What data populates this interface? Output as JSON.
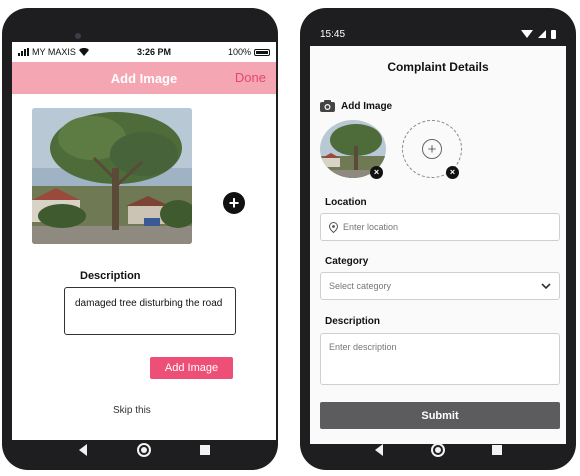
{
  "left_phone": {
    "status": {
      "carrier": "MY MAXIS",
      "time": "3:26 PM",
      "battery": "100%"
    },
    "header": {
      "title": "Add Image",
      "done_label": "Done"
    },
    "add_icon": "plus-icon",
    "description_label": "Description",
    "description_value": "damaged tree disturbing the road",
    "add_image_button": "Add Image",
    "skip_label": "Skip this"
  },
  "right_phone": {
    "status": {
      "time": "15:45"
    },
    "title": "Complaint Details",
    "add_image_label": "Add Image",
    "location_label": "Location",
    "location_placeholder": "Enter location",
    "category_label": "Category",
    "category_placeholder": "Select category",
    "description_label": "Description",
    "description_placeholder": "Enter description",
    "submit_label": "Submit"
  },
  "colors": {
    "pink_header": "#f4a6b3",
    "pink_accent": "#ee4f77",
    "done_text": "#e8456c",
    "submit_bg": "#5c5c5e",
    "phone_body": "#1e1e20"
  },
  "icons": [
    "back-icon",
    "home-icon",
    "recents-icon",
    "camera-icon",
    "location-pin-icon",
    "chevron-down-icon",
    "close-icon",
    "plus-icon"
  ]
}
